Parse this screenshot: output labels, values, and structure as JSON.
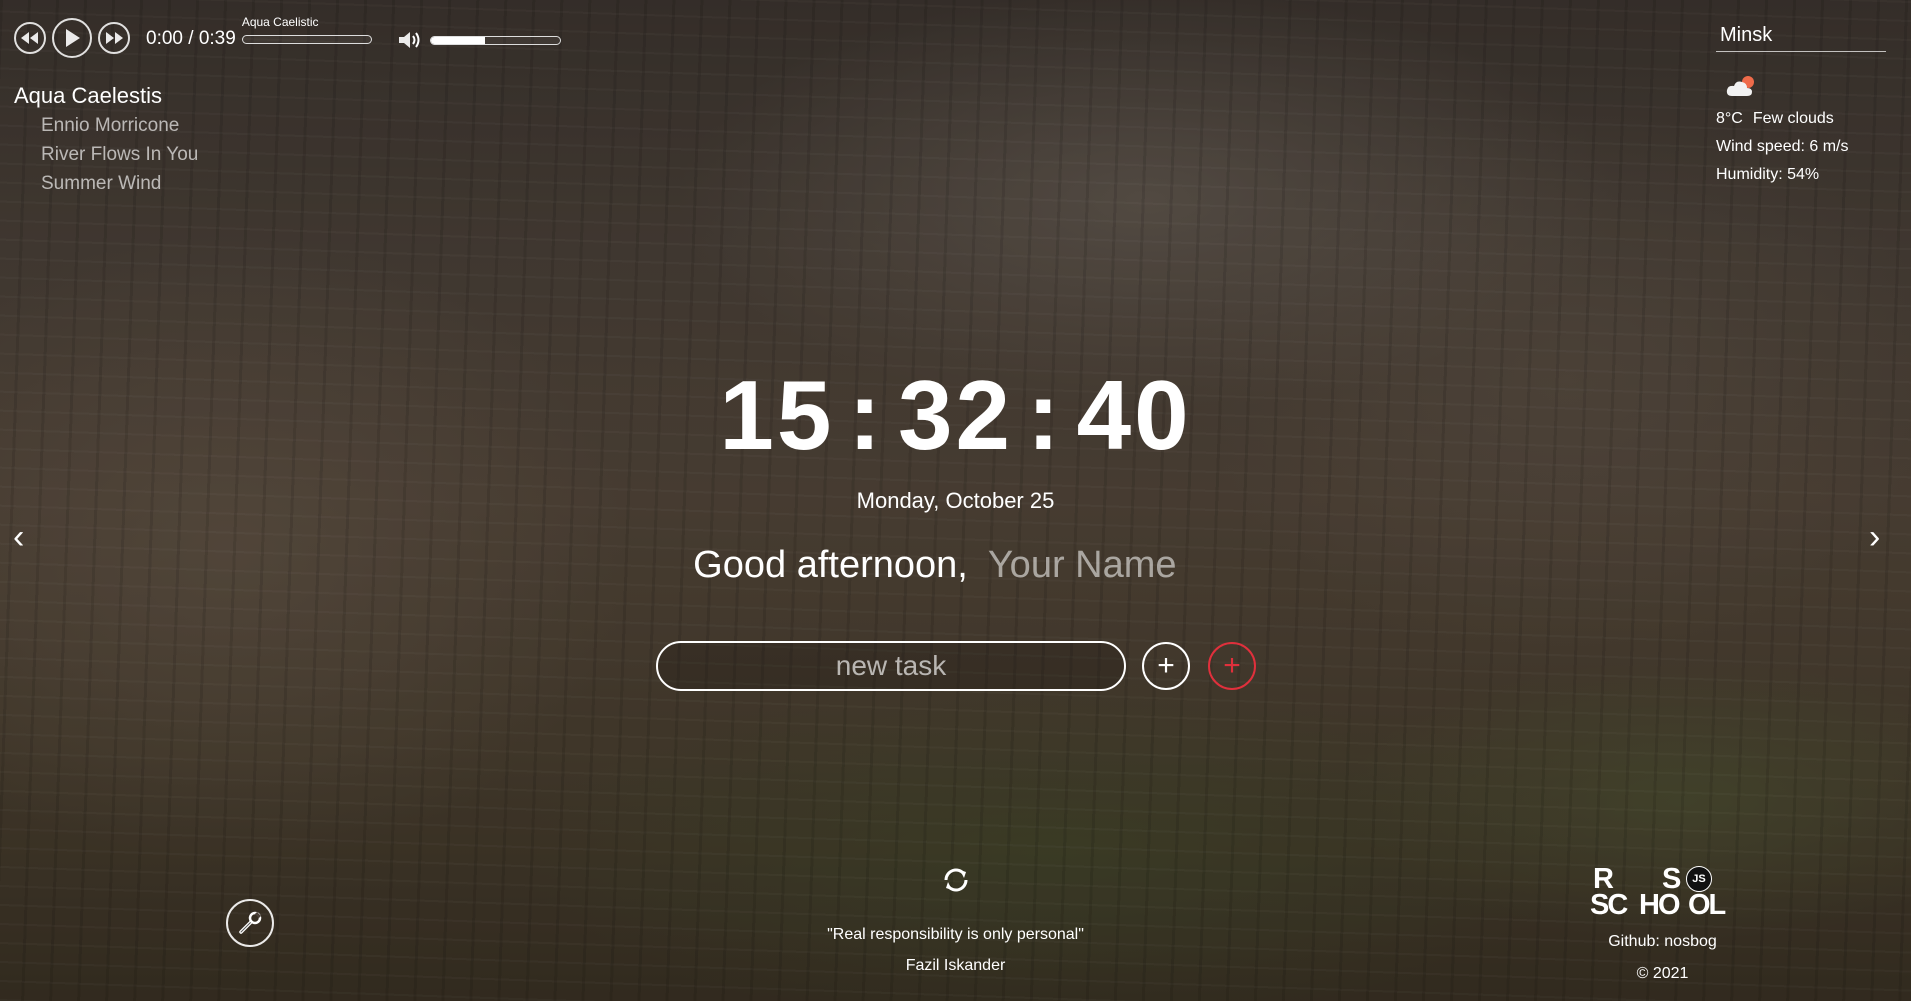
{
  "player": {
    "current_time": "0:00",
    "separator": " / ",
    "duration": "0:39",
    "track_title": "Aqua Caelistic",
    "progress_fraction": 0.0,
    "volume_fraction": 0.42,
    "icons": {
      "prev": "rewind-icon",
      "play": "play-icon",
      "next": "fast-forward-icon",
      "volume": "speaker-icon"
    }
  },
  "playlist": {
    "current": "Aqua Caelestis",
    "items": [
      "Ennio Morricone",
      "River Flows In You",
      "Summer Wind"
    ]
  },
  "weather": {
    "city": "Minsk",
    "icon": "cloud-sun-icon",
    "temperature": "8°C",
    "description": "Few clouds",
    "wind": "Wind speed: 6 m/s",
    "humidity": "Humidity: 54%"
  },
  "clock": {
    "hours": "15",
    "minutes": "32",
    "seconds": "40",
    "sep": ":"
  },
  "date": "Monday, October 25",
  "greeting": {
    "text": "Good afternoon,",
    "name_placeholder": "Your Name"
  },
  "todo": {
    "placeholder": "new task",
    "add_label": "+",
    "list_label": "+"
  },
  "slider": {
    "prev": "‹",
    "next": "›"
  },
  "quote": {
    "text": "\"Real responsibility is only personal\"",
    "author": "Fazil Iskander"
  },
  "footer": {
    "logo": {
      "row1": [
        "R",
        "S"
      ],
      "row2": [
        "SC",
        "HO",
        "OL"
      ],
      "badge": "JS"
    },
    "github": "Github: nosbog",
    "copyright": "© 2021"
  },
  "colors": {
    "accent_red": "#e0303c",
    "text": "#ffffff"
  }
}
